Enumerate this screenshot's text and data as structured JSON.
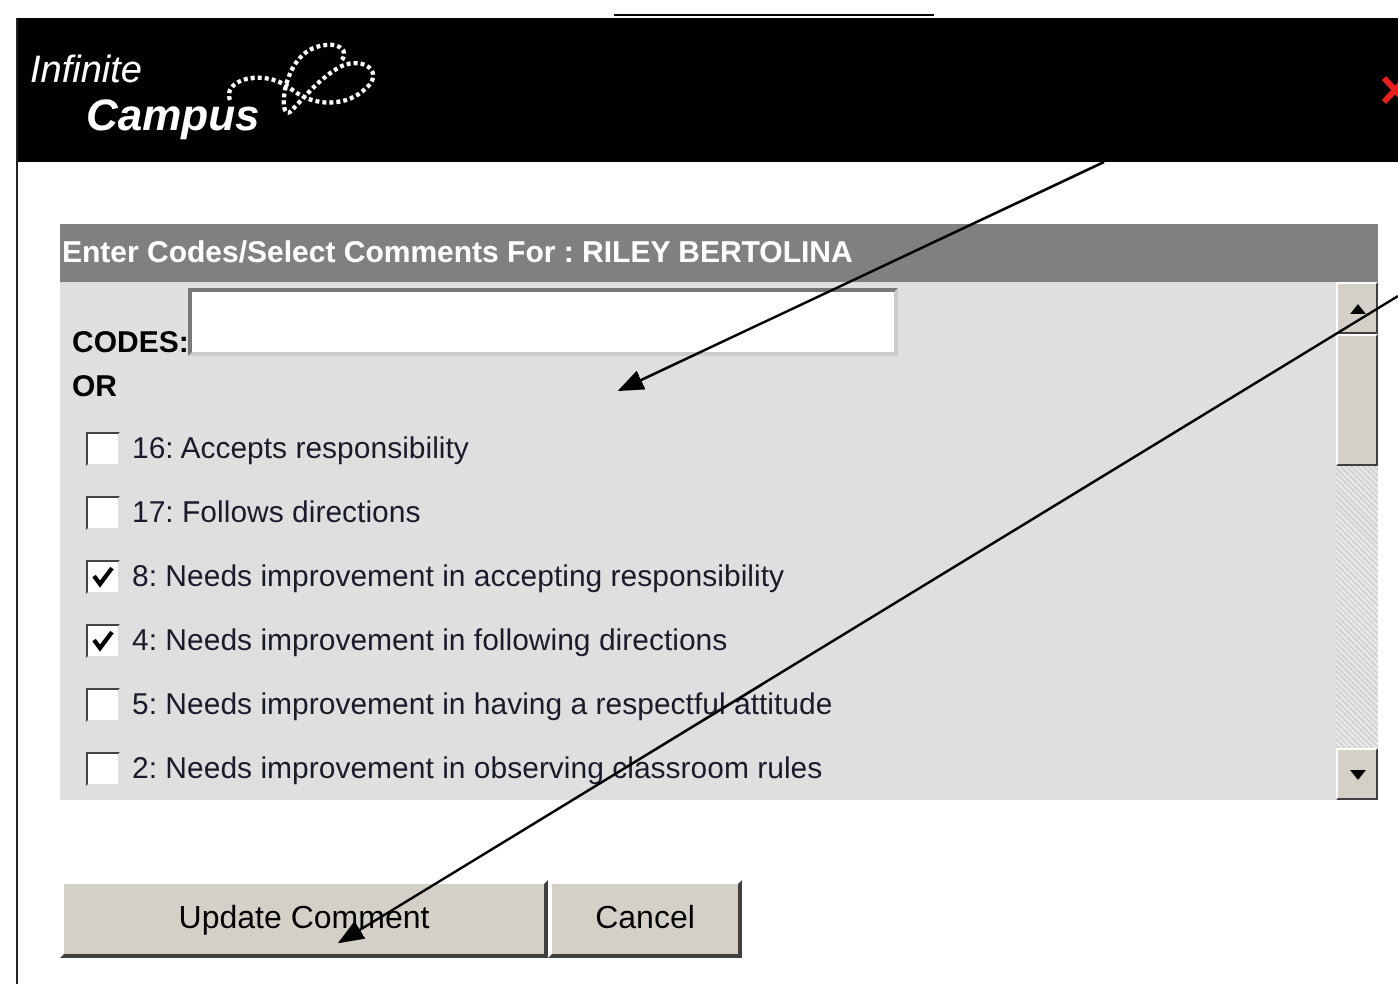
{
  "header": {
    "logo_line_1": "Infinite",
    "logo_line_2": "Campus"
  },
  "panel": {
    "title": "Enter Codes/Select Comments For : RILEY BERTOLINA",
    "codes_label": "CODES:",
    "or_label": "OR",
    "comments": [
      {
        "label": "16: Accepts responsibility",
        "checked": false
      },
      {
        "label": "17: Follows directions",
        "checked": false
      },
      {
        "label": "8: Needs improvement in accepting responsibility",
        "checked": true
      },
      {
        "label": "4: Needs improvement in following directions",
        "checked": true
      },
      {
        "label": "5: Needs improvement in having a respectful attitude",
        "checked": false
      },
      {
        "label": "2: Needs improvement in observing classroom rules",
        "checked": false
      }
    ]
  },
  "buttons": [
    "Update Comment",
    "Cancel"
  ]
}
